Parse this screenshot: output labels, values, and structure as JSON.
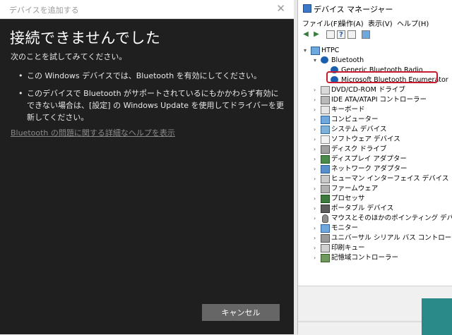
{
  "dialog": {
    "window_title": "デバイスを追加する",
    "close_glyph": "✕",
    "heading": "接続できませんでした",
    "intro": "次のことを試してみてください。",
    "bullet_glyph": "•",
    "bullets": [
      "この Windows デバイスでは、Bluetooth を有効にしてください。",
      "このデバイスで Bluetooth がサポートされているにもかかわらず有効にできない場合は、[設定] の Windows Update を使用してドライバーを更新してください。"
    ],
    "help_link": "Bluetooth の問題に関する詳細なヘルプを表示",
    "cancel_label": "キャンセル"
  },
  "device_manager": {
    "title": "デバイス マネージャー",
    "menu": [
      "ファイル(F)",
      "操作(A)",
      "表示(V)",
      "ヘルプ(H)"
    ],
    "toolbar_icons": [
      "back-arrow-icon",
      "forward-arrow-icon",
      "properties-icon",
      "help-icon",
      "update-icon",
      "monitor-icon"
    ],
    "toolbar_glyphs": [
      "◀",
      "▶",
      "",
      "?",
      "",
      ""
    ],
    "expander_open": "▾",
    "expander_closed": "›",
    "root": "HTPC",
    "bluetooth": {
      "label": "Bluetooth",
      "children": [
        "Generic Bluetooth Radio",
        "Microsoft Bluetooth Enumerator"
      ]
    },
    "categories": [
      "DVD/CD-ROM ドライブ",
      "IDE ATA/ATAPI コントローラー",
      "キーボード",
      "コンピューター",
      "システム デバイス",
      "ソフトウェア デバイス",
      "ディスク ドライブ",
      "ディスプレイ アダプター",
      "ネットワーク アダプター",
      "ヒューマン インターフェイス デバイス",
      "ファームウェア",
      "プロセッサ",
      "ポータブル デバイス",
      "マウスとそのほかのポインティング デバイス",
      "モニター",
      "ユニバーサル シリアル バス コントローラー",
      "印刷キュー",
      "記憶域コントローラー"
    ],
    "highlight_color": "#c81c2e"
  }
}
